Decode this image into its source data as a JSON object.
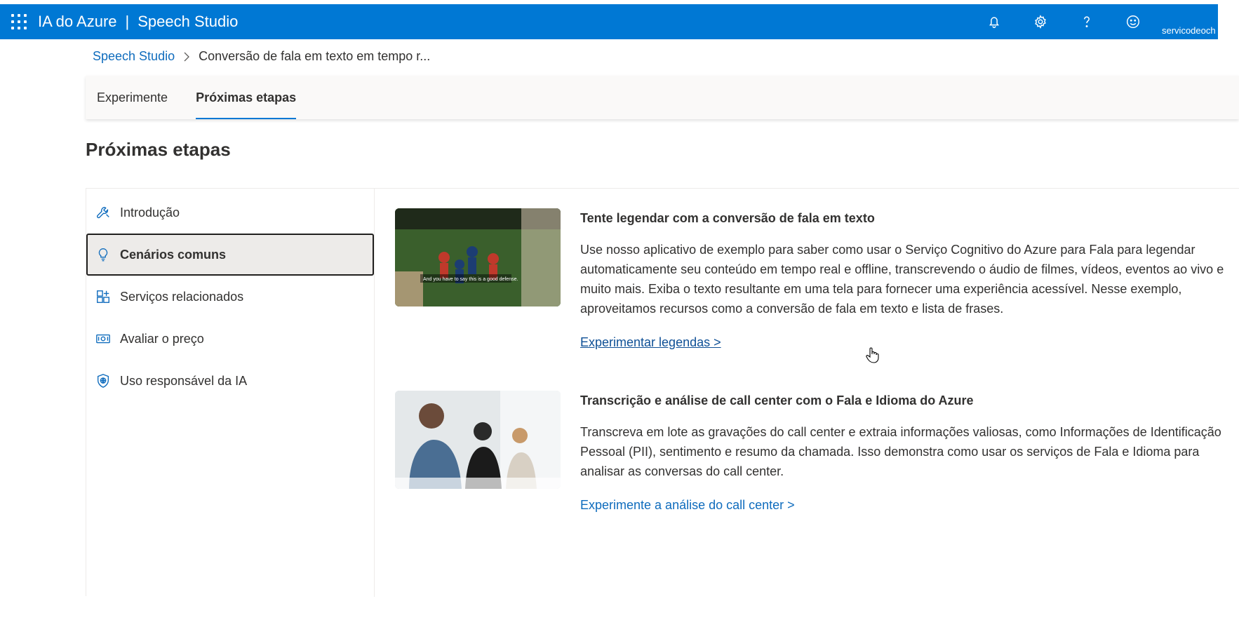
{
  "header": {
    "product": "IA do Azure",
    "separator": "|",
    "app": "Speech Studio",
    "account": "servicodeoch",
    "icons": [
      "notification-icon",
      "settings-icon",
      "help-icon",
      "feedback-icon"
    ]
  },
  "breadcrumb": {
    "root": "Speech Studio",
    "current": "Conversão de fala em texto em tempo r..."
  },
  "tabs": [
    {
      "label": "Experimente"
    },
    {
      "label": "Próximas etapas"
    }
  ],
  "page_title": "Próximas etapas",
  "sidenav": {
    "items": [
      {
        "label": "Introdução",
        "icon": "wrench-icon"
      },
      {
        "label": "Cenários comuns",
        "icon": "lightbulb-icon"
      },
      {
        "label": "Serviços relacionados",
        "icon": "apps-add-icon"
      },
      {
        "label": "Avaliar o preço",
        "icon": "money-icon"
      },
      {
        "label": "Uso responsável da IA",
        "icon": "shield-globe-icon"
      }
    ],
    "selected": "Cenários comuns"
  },
  "cards": [
    {
      "title": "Tente legendar com a conversão de fala em texto",
      "description": "Use nosso aplicativo de exemplo para saber como usar o Serviço Cognitivo do Azure para Fala para legendar automaticamente seu conteúdo em tempo real e offline, transcrevendo o áudio de filmes, vídeos, eventos ao vivo e muito mais. Exiba o texto resultante em uma tela para fornecer uma experiência acessível. Nesse exemplo, aproveitamos recursos como a conversão de fala em texto e lista de frases.",
      "link": "Experimentar legendas >",
      "image_caption": "And you have to say this is a good defense."
    },
    {
      "title": "Transcrição e análise de call center com o Fala e Idioma do Azure",
      "description": "Transcreva em lote as gravações do call center e extraia informações valiosas, como Informações de Identificação Pessoal (PII), sentimento e resumo da chamada. Isso demonstra como usar os serviços de Fala e Idioma para analisar as conversas do call center.",
      "link": "Experimente a análise do call center >"
    }
  ]
}
